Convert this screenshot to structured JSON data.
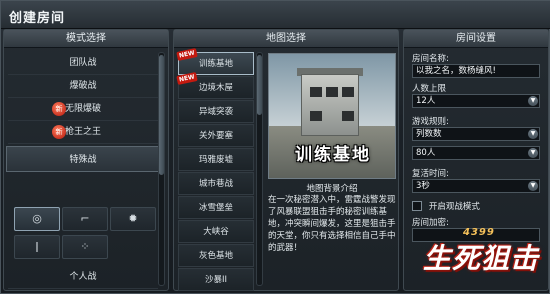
{
  "window": {
    "title": "创建房间"
  },
  "mode_panel": {
    "header": "模式选择",
    "items": [
      {
        "label": "团队战",
        "new": false,
        "selected": false
      },
      {
        "label": "爆破战",
        "new": false,
        "selected": false
      },
      {
        "label": "无限爆破",
        "new": true,
        "selected": false
      },
      {
        "label": "枪王之王",
        "new": true,
        "selected": false
      },
      {
        "label": "特殊战",
        "new": false,
        "selected": true
      },
      {
        "label": "个人战",
        "new": false,
        "selected": false
      }
    ],
    "new_badge": "新",
    "weapon_icons": [
      {
        "icon": "crosshair-icon",
        "glyph": "◎",
        "active": true
      },
      {
        "icon": "pistol-icon",
        "glyph": "⌐",
        "active": false
      },
      {
        "icon": "grenade-icon",
        "glyph": "✹",
        "active": false
      },
      {
        "icon": "knife-icon",
        "glyph": "ǀ",
        "active": false
      },
      {
        "icon": "dots-icon",
        "glyph": "⁘",
        "active": false
      }
    ]
  },
  "map_panel": {
    "header": "地图选择",
    "new_tag": "NEW",
    "maps": [
      {
        "label": "训练基地",
        "new": true,
        "selected": true
      },
      {
        "label": "边境木屋",
        "new": true,
        "selected": false
      },
      {
        "label": "异域突袭",
        "new": false,
        "selected": false
      },
      {
        "label": "关外要塞",
        "new": false,
        "selected": false
      },
      {
        "label": "玛雅废墟",
        "new": false,
        "selected": false
      },
      {
        "label": "城市巷战",
        "new": false,
        "selected": false
      },
      {
        "label": "冰雪堡垒",
        "new": false,
        "selected": false
      },
      {
        "label": "大峡谷",
        "new": false,
        "selected": false
      },
      {
        "label": "灰色基地",
        "new": false,
        "selected": false
      },
      {
        "label": "沙暴II",
        "new": false,
        "selected": false
      }
    ],
    "preview_title": "训练基地",
    "intro_heading": "地图背景介绍",
    "intro_text": "在一次秘密潜入中，雷霆战警发现了风暴联盟狙击手的秘密训练基地，冲突瞬间爆发，这里是狙击手的天堂，你只有选择相信自己手中的武器！"
  },
  "room_panel": {
    "header": "房间设置",
    "room_name_label": "房间名称:",
    "room_name_value": "以我之名，数杨缝风!",
    "max_players_label": "人数上限",
    "max_players_value": "12人",
    "victory_rule_label": "游戏规则:",
    "victory_rule_value": "列数数",
    "kill_count_value": "80人",
    "revive_label": "复活时间:",
    "revive_value": "3秒",
    "spectator_label": "开启观战模式",
    "password_label": "房间加密:",
    "select_arrow": "▼"
  },
  "logo": {
    "number": "4399",
    "text": "生死狙击"
  }
}
